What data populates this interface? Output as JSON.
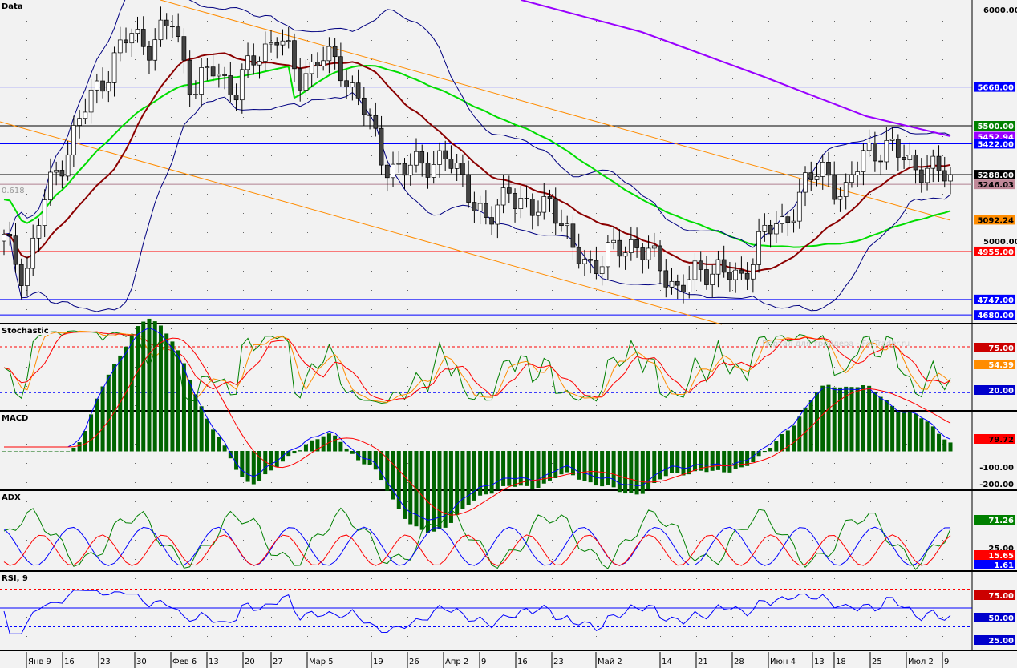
{
  "panels": {
    "main": "Data",
    "stoch": "Stochastic",
    "macd": "MACD",
    "adx": "ADX",
    "rsi": "RSI, 9"
  },
  "watermark": "Портал для трейдера - ForTrader.ru",
  "fibo_label": "0.618",
  "chart_data": {
    "type": "candlestick",
    "ylim": [
      4660,
      6050
    ],
    "xlabels": [
      "Янв 9",
      "16",
      "23",
      "30",
      "Фев 6",
      "13",
      "20",
      "27",
      "Мар 5",
      "19",
      "26",
      "Апр 2",
      "9",
      "16",
      "23",
      "Май 2",
      "14",
      "21",
      "28",
      "Июн 4",
      "13",
      "18",
      "25",
      "Июл 2",
      "9"
    ],
    "key_closes": [
      5000,
      4850,
      5200,
      5400,
      5600,
      5750,
      5900,
      5850,
      5950,
      5650,
      5750,
      5650,
      5800,
      5900,
      5700,
      5800,
      5750,
      5600,
      5350,
      5300,
      5350,
      5350,
      5250,
      5050,
      5250,
      5100,
      5200,
      4950,
      4900,
      4950,
      5000,
      4900,
      4800,
      4850,
      4900,
      4800,
      5050,
      5050,
      5250,
      5300,
      5200,
      5400,
      5400,
      5350,
      5300,
      5288
    ],
    "price_ticks": [
      "6000.00",
      "5000.00"
    ],
    "levels": [
      {
        "value": 5668,
        "label": "5668.00",
        "color": "#0000ff"
      },
      {
        "value": 5500,
        "label": "5500.00",
        "color": "#008000"
      },
      {
        "value": 5452.94,
        "label": "5452.94",
        "color": "#9900ff"
      },
      {
        "value": 5422,
        "label": "5422.00",
        "color": "#0000ff"
      },
      {
        "value": 5288,
        "label": "5288.00",
        "color": "#000000"
      },
      {
        "value": 5246.03,
        "label": "5246.03",
        "color": "#b08090"
      },
      {
        "value": 5092.24,
        "label": "5092.24",
        "color": "#ff8c00"
      },
      {
        "value": 4955,
        "label": "4955.00",
        "color": "#ff0000"
      },
      {
        "value": 4747,
        "label": "4747.00",
        "color": "#0000ff"
      },
      {
        "value": 4680,
        "label": "4680.00",
        "color": "#0000ff"
      }
    ],
    "stochastic": {
      "levels": [
        "75.00",
        "20.00"
      ],
      "value_label": "54.39"
    },
    "macd": {
      "ticks": [
        "-100.00",
        "-200.00"
      ],
      "value_label": "79.72"
    },
    "adx": {
      "tick": "25.00",
      "values": [
        "71.26",
        "15.65",
        "1.61"
      ]
    },
    "rsi": {
      "levels": [
        "75.00",
        "50.00",
        "25.00"
      ]
    }
  }
}
